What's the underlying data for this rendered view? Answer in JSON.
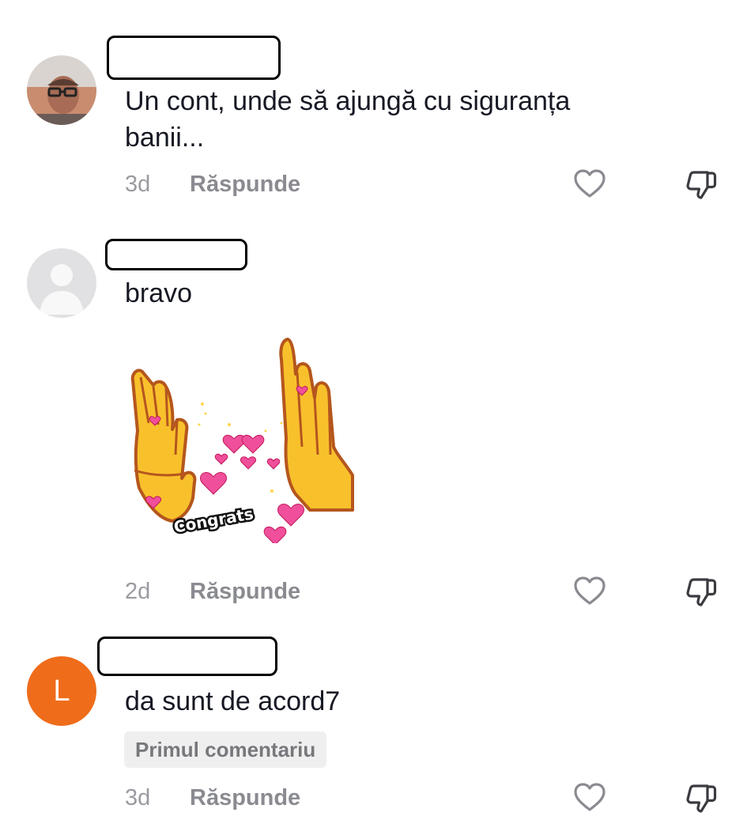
{
  "comments": [
    {
      "text": "Un cont, unde să ajungă cu siguranța\nbanii...",
      "time": "3d",
      "reply": "Răspunde"
    },
    {
      "text": "bravo",
      "time": "2d",
      "reply": "Răspunde",
      "sticker_text": "Congrats"
    },
    {
      "avatar_letter": "L",
      "text": "da sunt de acord7",
      "badge": "Primul comentariu",
      "time": "3d",
      "reply": "Răspunde"
    }
  ],
  "colors": {
    "text": "#161823",
    "meta": "#9a9ba0",
    "avatar_orange": "#ef6c1a",
    "badge_bg": "#efefef"
  },
  "icons": {
    "like": "heart-outline-icon",
    "dislike": "thumbs-down-icon"
  }
}
